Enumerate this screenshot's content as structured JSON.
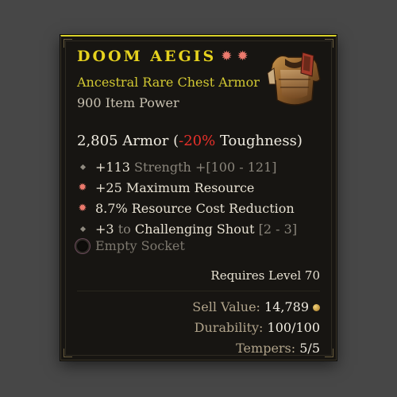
{
  "item": {
    "name": "Doom Aegis",
    "type": "Ancestral Rare Chest Armor",
    "item_power": "900 Item Power",
    "greater_affix_icons": [
      "star-icon",
      "star-icon"
    ],
    "image_icon": "chest-armor-icon"
  },
  "armor": {
    "value": "2,805 Armor",
    "open_paren": " (",
    "toughness_change": "-20%",
    "toughness_label": " Toughness)"
  },
  "affixes": [
    {
      "icon": "diamond-icon",
      "value": "+113",
      "stat": "Strength",
      "range": "+[100 - 121]"
    },
    {
      "icon": "greater-affix-icon",
      "text": "+25 Maximum Resource"
    },
    {
      "icon": "greater-affix-icon",
      "text": "8.7% Resource Cost Reduction"
    },
    {
      "icon": "diamond-icon",
      "value": "+3",
      "mid": "to",
      "stat": "Challenging Shout",
      "range": "[2 - 3]"
    }
  ],
  "socket": {
    "label": "Empty Socket"
  },
  "requirements": {
    "level": "Requires Level 70"
  },
  "footer": {
    "sell_label": "Sell Value:",
    "sell_value": "14,789",
    "durability_label": "Durability:",
    "durability_value": "100/100",
    "tempers_label": "Tempers:",
    "tempers_value": "5/5"
  },
  "colors": {
    "legendary_yellow": "#e6d21e",
    "rare_subtitle": "#d2c832",
    "negative_red": "#e8302a",
    "greater_affix": "#ec7a6d",
    "background": "#171512"
  }
}
